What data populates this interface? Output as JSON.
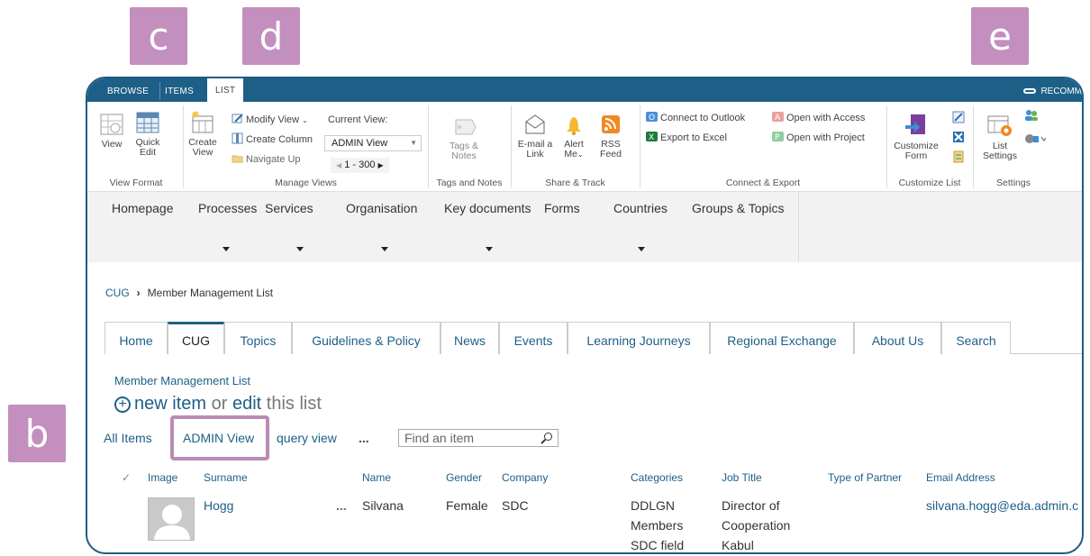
{
  "badges": {
    "c": "c",
    "d": "d",
    "e": "e",
    "b": "b"
  },
  "ribbon_tabs": [
    "BROWSE",
    "ITEMS",
    "LIST"
  ],
  "recommend_label": "RECOMM",
  "ribbon": {
    "view": "View",
    "quick_edit": [
      "Quick",
      "Edit"
    ],
    "create_view": [
      "Create",
      "View"
    ],
    "modify_view": "Modify View",
    "create_column": "Create Column",
    "navigate_up": "Navigate Up",
    "current_view_label": "Current View:",
    "current_view_value": "ADMIN View",
    "pager": "1 - 300",
    "tags_notes": [
      "Tags &",
      "Notes"
    ],
    "email_link": [
      "E-mail a",
      "Link"
    ],
    "alert_me": [
      "Alert",
      "Me"
    ],
    "rss_feed": [
      "RSS",
      "Feed"
    ],
    "connect_outlook": "Connect to Outlook",
    "export_excel": "Export to Excel",
    "open_access": "Open with Access",
    "open_project": "Open with Project",
    "customize_form": [
      "Customize",
      "Form"
    ],
    "list_settings": [
      "List",
      "Settings"
    ],
    "groups": [
      "View Format",
      "Manage Views",
      "Tags and Notes",
      "Share & Track",
      "Connect & Export",
      "Customize List",
      "Settings"
    ]
  },
  "top_nav": [
    "Homepage",
    "Processes",
    "Services",
    "Organisation",
    "Key documents",
    "Forms",
    "Countries",
    "Groups & Topics"
  ],
  "breadcrumb": {
    "root": "CUG",
    "separator": "›",
    "current": "Member Management List"
  },
  "page_tabs": [
    "Home",
    "CUG",
    "Topics",
    "Guidelines & Policy",
    "News",
    "Events",
    "Learning Journeys",
    "Regional Exchange",
    "About Us",
    "Search"
  ],
  "list_title": "Member Management List",
  "new_item": {
    "new": "new item",
    "or": "or",
    "edit": "edit",
    "rest": "this list"
  },
  "views": {
    "all_items": "All Items",
    "admin_view": "ADMIN View",
    "query_view": "query view",
    "more": "...",
    "search_placeholder": "Find an item"
  },
  "columns": [
    "Image",
    "Surname",
    "Name",
    "Gender",
    "Company",
    "Categories",
    "Job Title",
    "Type of Partner",
    "Email Address"
  ],
  "row": {
    "surname": "Hogg",
    "menu": "...",
    "name": "Silvana",
    "gender": "Female",
    "company": "SDC",
    "categories": [
      "DDLGN",
      "Members",
      "SDC field"
    ],
    "job_title": [
      "Director of",
      "Cooperation",
      "Kabul"
    ],
    "email": "silvana.hogg@eda.admin.c"
  }
}
